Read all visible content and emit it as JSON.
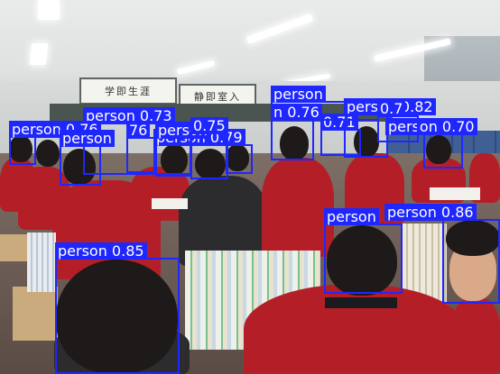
{
  "image": {
    "signs": [
      "学即生涯",
      "静即室入"
    ]
  },
  "detections": [
    {
      "label": "person 0.85",
      "class": "person",
      "score": 0.85
    },
    {
      "label": "person 0.86",
      "class": "person",
      "score": 0.86
    },
    {
      "label": "person",
      "class": "person",
      "score": null
    },
    {
      "label": "person 0.82",
      "class": "person",
      "score": 0.82
    },
    {
      "label": "person 0.70",
      "class": "person",
      "score": 0.7
    },
    {
      "label": "person 0.73",
      "class": "person",
      "score": 0.73
    },
    {
      "label": "person 0.76",
      "class": "person",
      "score": 0.76
    },
    {
      "label": "person 0.79",
      "class": "person",
      "score": 0.79
    },
    {
      "label": "n 0.76",
      "class": "person",
      "score": 0.76
    },
    {
      "label": "0.71",
      "class": "person",
      "score": 0.71
    },
    {
      "label": "person",
      "class": "person",
      "score": null
    },
    {
      "label": "person",
      "class": "person",
      "score": null
    },
    {
      "label": "person",
      "class": "person",
      "score": null
    },
    {
      "label": "76",
      "class": "person",
      "score": null
    },
    {
      "label": "0.7",
      "class": "person",
      "score": null
    },
    {
      "label": "0.75",
      "class": "person",
      "score": 0.75
    }
  ],
  "colors": {
    "box": "#1f27ff",
    "label_text": "#ffffff"
  }
}
